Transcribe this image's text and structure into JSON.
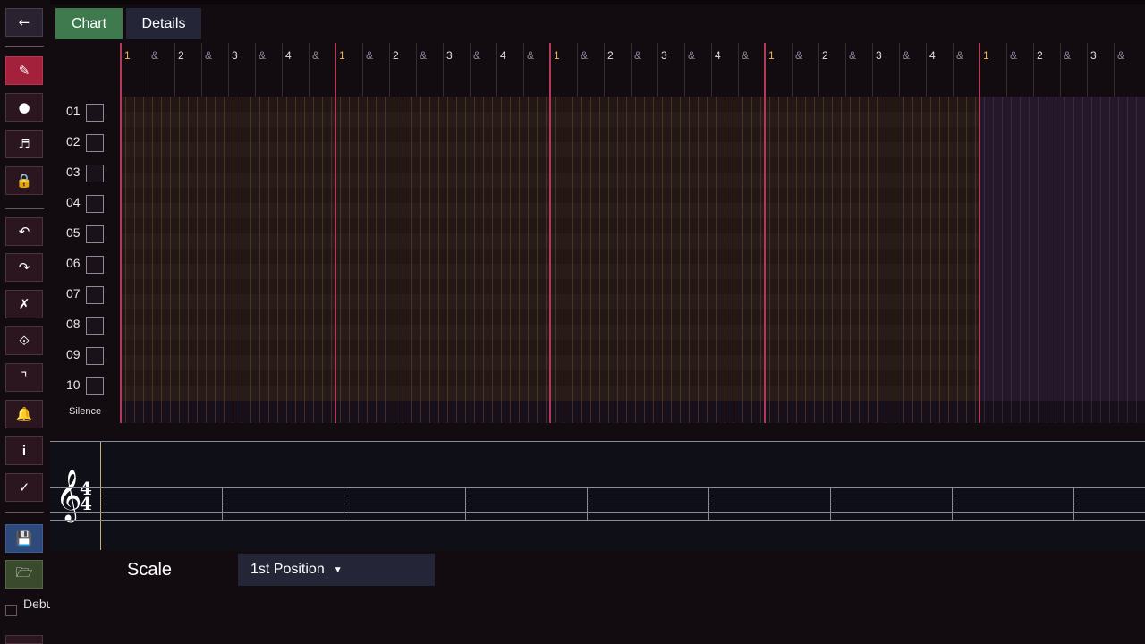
{
  "tabs": {
    "chart": "Chart",
    "details": "Details"
  },
  "sidebar": {
    "buttons": [
      {
        "name": "back-button",
        "icon": "arrow-left-icon",
        "glyph": "←",
        "style": "grey"
      },
      {
        "name": "pencil-button",
        "icon": "pencil-icon",
        "glyph": "✎",
        "style": "red"
      },
      {
        "name": "record-button",
        "icon": "dot-icon",
        "glyph": "●",
        "style": ""
      },
      {
        "name": "note-button",
        "icon": "music-note-icon",
        "glyph": "♬",
        "style": ""
      },
      {
        "name": "lock-button",
        "icon": "lock-icon",
        "glyph": "🔒",
        "style": ""
      },
      {
        "name": "undo-button",
        "icon": "undo-icon",
        "glyph": "↶",
        "style": ""
      },
      {
        "name": "redo-button",
        "icon": "redo-icon",
        "glyph": "↷",
        "style": ""
      },
      {
        "name": "delete-button",
        "icon": "cross-icon",
        "glyph": "✗",
        "style": ""
      },
      {
        "name": "select-button",
        "icon": "diamond-icon",
        "glyph": "⟐",
        "style": ""
      },
      {
        "name": "corner-button",
        "icon": "corner-icon",
        "glyph": "⌝",
        "style": ""
      },
      {
        "name": "metronome-button",
        "icon": "bell-icon",
        "glyph": "🔔",
        "style": ""
      },
      {
        "name": "info-button",
        "icon": "info-icon",
        "glyph": "i",
        "style": ""
      },
      {
        "name": "check-button",
        "icon": "check-icon",
        "glyph": "✓",
        "style": ""
      },
      {
        "name": "save-button",
        "icon": "floppy-icon",
        "glyph": "💾",
        "style": "blue"
      },
      {
        "name": "open-button",
        "icon": "folder-icon",
        "glyph": "🗁",
        "style": "green"
      }
    ],
    "debug_label": "Debug Record"
  },
  "beats": [
    "1",
    "&",
    "2",
    "&",
    "3",
    "&",
    "4",
    "&"
  ],
  "rows": [
    "01",
    "02",
    "03",
    "04",
    "05",
    "06",
    "07",
    "08",
    "09",
    "10"
  ],
  "silence_label": "Silence",
  "staff": {
    "clef": "𝄞",
    "time_top": "4",
    "time_bottom": "4"
  },
  "scale": {
    "label": "Scale",
    "value": "1st Position"
  },
  "colors": {
    "measure_line": "#b03a5a",
    "downbeat": "#e8b84a",
    "string_line": "#b8733a",
    "accent_tab": "#3f7a4e"
  }
}
